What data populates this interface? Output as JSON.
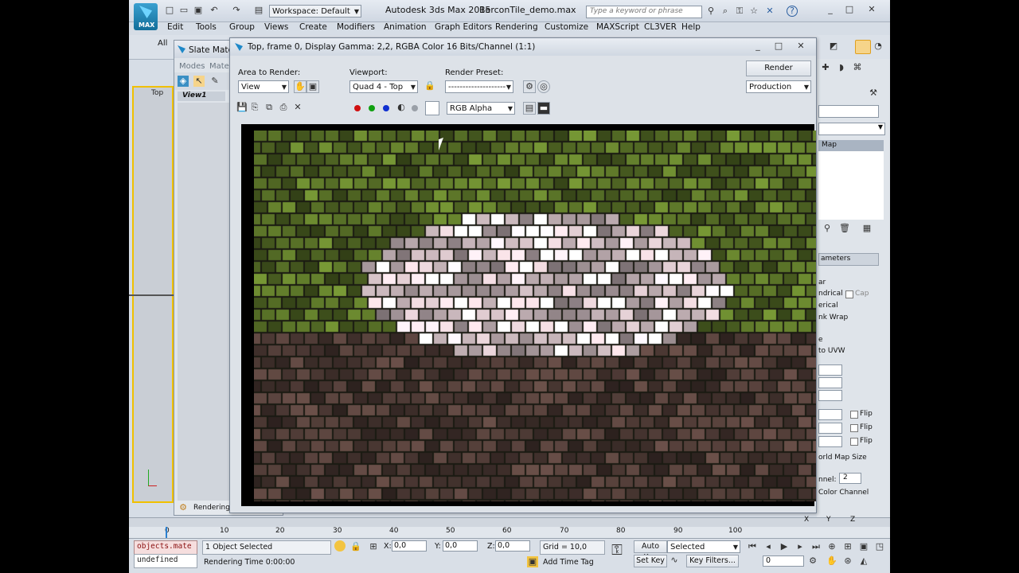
{
  "app": {
    "title": "Autodesk 3ds Max  2015",
    "file_name": "BerconTile_demo.max",
    "workspace": "Workspace: Default",
    "search_placeholder": "Type a keyword or phrase",
    "logo_text": "MAX"
  },
  "menu": [
    "Edit",
    "Tools",
    "Group",
    "Views",
    "Create",
    "Modifiers",
    "Animation",
    "Graph Editors",
    "Rendering",
    "Customize",
    "MAXScript",
    "CL3VER",
    "Help"
  ],
  "slate": {
    "title": "Slate Materi",
    "menu_modes": "Modes",
    "menu_mate": "Mate",
    "view_tab": "View1",
    "status": "Rendering fi",
    "all_label": "All"
  },
  "viewport_label": "Top",
  "render_window": {
    "title": "Top, frame 0, Display Gamma: 2,2, RGBA Color 16 Bits/Channel (1:1)",
    "area_label": "Area to Render:",
    "area_value": "View",
    "viewport_label": "Viewport:",
    "viewport_value": "Quad 4 - Top",
    "preset_label": "Render Preset:",
    "preset_value": "--------------------",
    "render_button": "Render",
    "render_mode": "Production",
    "channel_value": "RGB Alpha"
  },
  "right_panel": {
    "map_item": "Map",
    "section": "ameters",
    "opts": [
      "ar",
      "ndrical",
      "erical",
      "nk Wrap",
      "e",
      "to UVW"
    ],
    "cap": "Cap",
    "flip": "Flip",
    "world_map": "orld Map Size",
    "channel_label": "nnel:",
    "channel_value": "2",
    "color_channel": "Color Channel",
    "xyz": [
      "X",
      "Y",
      "Z"
    ]
  },
  "timeline": {
    "ticks": [
      "0",
      "10",
      "20",
      "30",
      "40",
      "50",
      "60",
      "70",
      "80",
      "90",
      "100"
    ]
  },
  "status_bar": {
    "script1": "objects.mate",
    "script2": "undefined",
    "selected": "1 Object Selected",
    "render_time": "Rendering Time  0:00:00",
    "x_label": "X:",
    "x_value": "0,0",
    "y_label": "Y:",
    "y_value": "0,0",
    "z_label": "Z:",
    "z_value": "0,0",
    "grid": "Grid = 10,0",
    "add_time_tag": "Add Time Tag",
    "auto_key": "Auto Key",
    "set_key": "Set Key",
    "selected_dd": "Selected",
    "key_filters": "Key Filters...",
    "frame_value": "0"
  },
  "colors": {
    "app_bg": "#d6dde6",
    "title_accent": "#1e88c8",
    "render_bg": "#000000"
  }
}
